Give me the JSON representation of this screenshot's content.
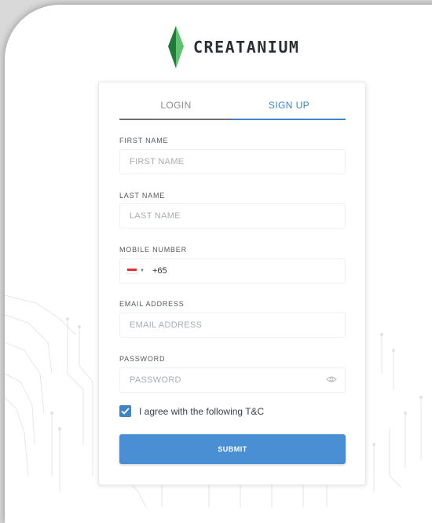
{
  "brand": {
    "name": "CREATANIUM"
  },
  "tabs": [
    {
      "label": "LOGIN",
      "active": false
    },
    {
      "label": "SIGN UP",
      "active": true
    }
  ],
  "form": {
    "first_name": {
      "label": "FIRST NAME",
      "placeholder": "FIRST NAME",
      "value": ""
    },
    "last_name": {
      "label": "LAST NAME",
      "placeholder": "LAST NAME",
      "value": ""
    },
    "mobile": {
      "label": "MOBILE NUMBER",
      "country_flag": "flag-singapore-icon",
      "dial_code": "+65",
      "value": ""
    },
    "email": {
      "label": "EMAIL ADDRESS",
      "placeholder": "EMAIL ADDRESS",
      "value": ""
    },
    "password": {
      "label": "PASSWORD",
      "placeholder": "PASSWORD",
      "value": ""
    },
    "agree": {
      "label": "I agree with the following T&C",
      "checked": true
    },
    "submit_label": "SUBMIT"
  },
  "colors": {
    "accent": "#3d85c6",
    "submit": "#4a8fd3",
    "logo_dark_green": "#1f7a3b",
    "logo_light_green": "#5cc26b"
  }
}
